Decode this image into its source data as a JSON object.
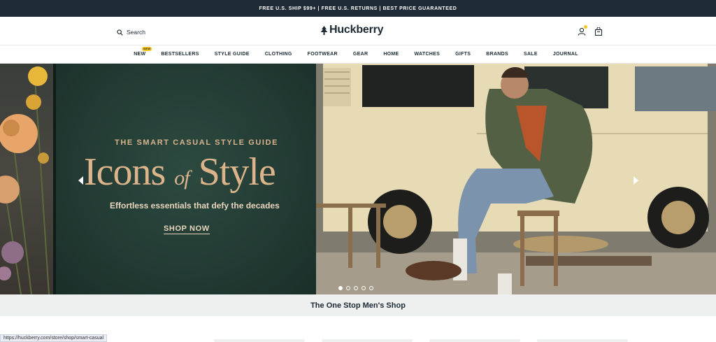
{
  "announcement": {
    "text": "FREE U.S. SHIP $99+  |  FREE U.S. RETURNS  |  BEST PRICE GUARANTEED"
  },
  "header": {
    "search_label": "Search",
    "logo_text": "Huckberry",
    "icons": [
      "search-icon",
      "tree-icon",
      "account-icon",
      "cart-icon"
    ]
  },
  "nav": {
    "items": [
      {
        "label": "NEW",
        "badge": "NEW"
      },
      {
        "label": "BESTSELLERS"
      },
      {
        "label": "STYLE GUIDE"
      },
      {
        "label": "CLOTHING"
      },
      {
        "label": "FOOTWEAR"
      },
      {
        "label": "GEAR"
      },
      {
        "label": "HOME"
      },
      {
        "label": "WATCHES"
      },
      {
        "label": "GIFTS"
      },
      {
        "label": "BRANDS"
      },
      {
        "label": "SALE"
      },
      {
        "label": "JOURNAL"
      }
    ]
  },
  "hero": {
    "kicker": "THE SMART CASUAL STYLE GUIDE",
    "title_part1": "Icons ",
    "title_of": "of",
    "title_part2": " Style",
    "subtitle": "Effortless essentials that defy the decades",
    "cta": "SHOP NOW",
    "slide_count": 5,
    "active_slide": 1
  },
  "tagline": "The One Stop Men's Shop",
  "status_url": "https://huckberry.com/store/shop/smart-casual",
  "colors": {
    "announcement_bg": "#1f2b36",
    "accent_yellow": "#f4c51b",
    "hero_text": "#dcb48c",
    "tagline_bg": "#eef0f0"
  }
}
